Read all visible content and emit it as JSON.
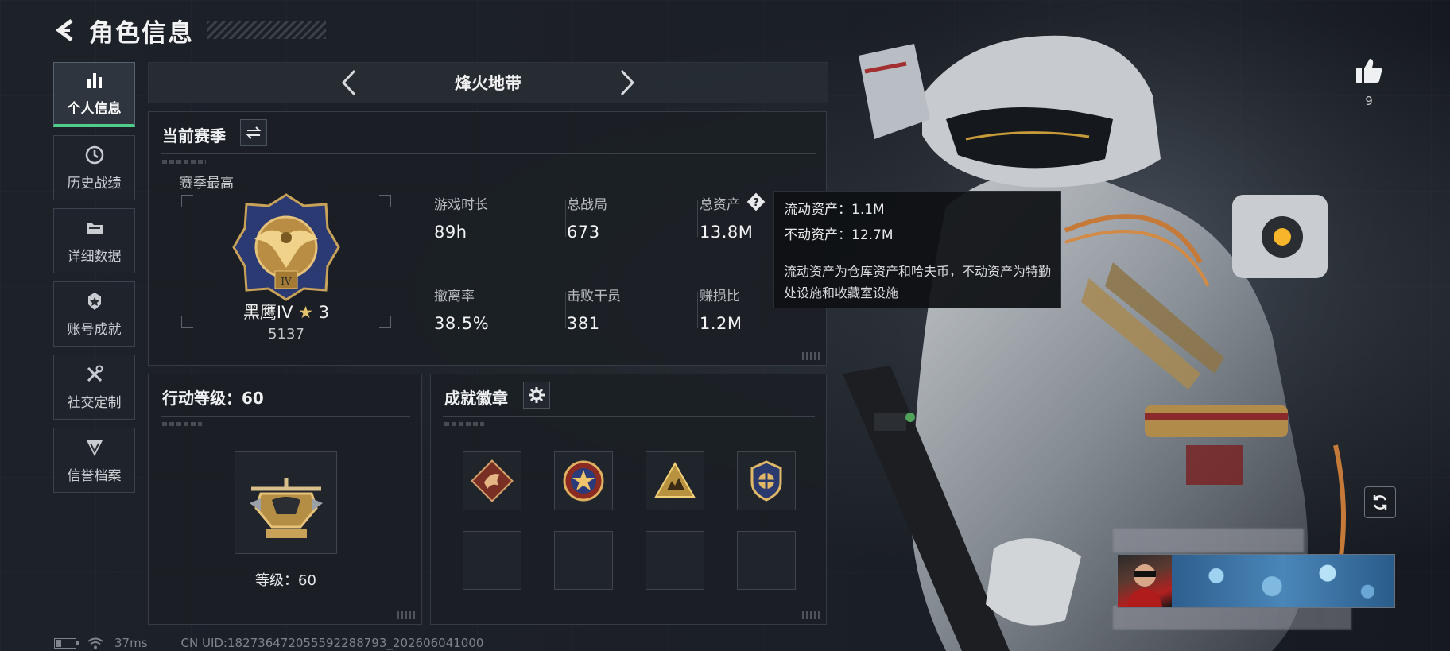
{
  "header": {
    "title": "角色信息"
  },
  "sidebar": {
    "items": [
      {
        "label": "个人信息",
        "icon": "bar-chart-icon",
        "active": true
      },
      {
        "label": "历史战绩",
        "icon": "history-clock-icon",
        "active": false
      },
      {
        "label": "详细数据",
        "icon": "folder-icon",
        "active": false
      },
      {
        "label": "账号成就",
        "icon": "achievement-badge-icon",
        "active": false
      },
      {
        "label": "社交定制",
        "icon": "tools-icon",
        "active": false
      },
      {
        "label": "信誉档案",
        "icon": "shield-rank-icon",
        "active": false
      }
    ]
  },
  "mode": {
    "name": "烽火地带"
  },
  "season": {
    "title": "当前赛季",
    "best_label": "赛季最高",
    "rank_name": "黑鹰IV",
    "rank_stars": "3",
    "rank_score": "5137",
    "stats": [
      {
        "label": "游戏时长",
        "value": "89h"
      },
      {
        "label": "总战局",
        "value": "673"
      },
      {
        "label": "总资产",
        "value": "13.8M"
      },
      {
        "label": "撤离率",
        "value": "38.5%"
      },
      {
        "label": "击败干员",
        "value": "381"
      },
      {
        "label": "赚损比",
        "value": "1.2M"
      }
    ]
  },
  "tooltip": {
    "liquid": "流动资产：1.1M",
    "fixed": "不动资产：12.7M",
    "description": "流动资产为仓库资产和哈夫币，不动资产为特勤处设施和收藏室设施"
  },
  "action_level": {
    "title": "行动等级：60",
    "level_text": "等级：60"
  },
  "badges": {
    "title": "成就徽章",
    "slots": [
      "dragon-badge",
      "star-emblem-badge",
      "triangle-squad-badge",
      "winged-shield-badge",
      "",
      "",
      "",
      ""
    ]
  },
  "likes": {
    "count": "9"
  },
  "footer": {
    "ping": "37ms",
    "uid": "CN UID:182736472055592288793_202606041000"
  },
  "colors": {
    "accent_green": "#4fcf8b",
    "panel_bg": "#1b1f25",
    "badge_gold": "#c9a25a"
  }
}
